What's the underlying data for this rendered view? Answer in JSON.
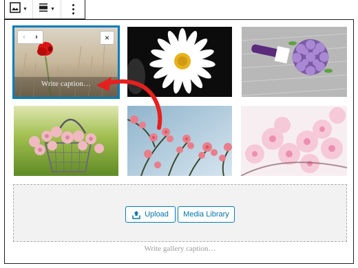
{
  "toolbar": {
    "items": [
      {
        "name": "change-items-per-row-icon"
      },
      {
        "name": "align-icon"
      },
      {
        "name": "more-options-icon"
      }
    ]
  },
  "gallery": {
    "images": [
      {
        "alt": "Red poppy in field",
        "selected": true
      },
      {
        "alt": "White daisy"
      },
      {
        "alt": "Purple flower bouquet"
      },
      {
        "alt": "Basket of pink roses"
      },
      {
        "alt": "Pink blossoms against sky"
      },
      {
        "alt": "Pink cherry blossoms"
      }
    ],
    "image_caption_placeholder": "Write caption…",
    "nav_prev": "‹",
    "nav_next": "›",
    "remove_icon": "×",
    "upload_label": "Upload",
    "media_library_label": "Media Library",
    "gallery_caption_placeholder": "Write gallery caption…"
  },
  "colors": {
    "accent": "#007cba",
    "link": "#0073aa",
    "annotation_arrow": "#e5201e"
  }
}
